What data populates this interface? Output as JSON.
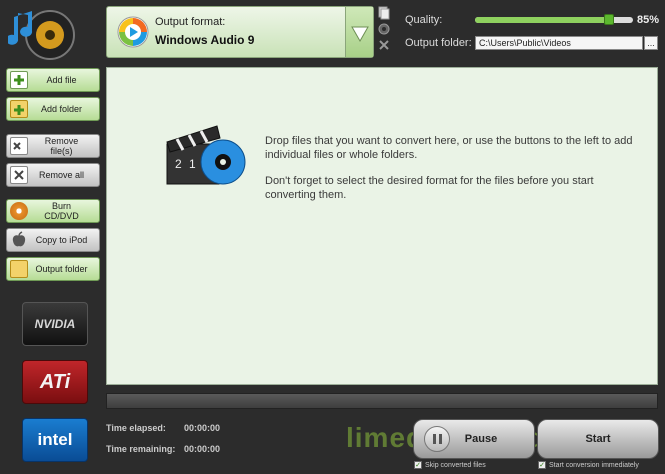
{
  "format": {
    "label": "Output format:",
    "value": "Windows Audio 9"
  },
  "quality": {
    "label": "Quality:",
    "value": "85%",
    "fraction": 0.85
  },
  "output_folder": {
    "label": "Output folder:",
    "value": "C:\\Users\\Public\\Videos",
    "browse_label": "..."
  },
  "sidebar": {
    "items": [
      {
        "label": "Add file",
        "icon": "add-file-icon"
      },
      {
        "label": "Add folder",
        "icon": "add-folder-icon"
      },
      {
        "label": "Remove file(s)",
        "icon": "remove-file-icon"
      },
      {
        "label": "Remove all",
        "icon": "remove-all-icon"
      },
      {
        "label": "Burn CD/DVD",
        "icon": "disc-icon"
      },
      {
        "label": "Copy to iPod",
        "icon": "apple-icon"
      },
      {
        "label": "Output folder",
        "icon": "folder-icon"
      }
    ]
  },
  "brands": {
    "nvidia": "NVIDIA",
    "ati": "ATi",
    "intel": "intel"
  },
  "drop_area": {
    "line1": "Drop files that you want to convert here, or use the buttons to the left to add individual files or whole folders.",
    "line2": "Don't forget to select the desired format for the files before you start converting them."
  },
  "status": {
    "elapsed_label": "Time elapsed:",
    "elapsed_value": "00:00:00",
    "remaining_label": "Time remaining:",
    "remaining_value": "00:00:00"
  },
  "controls": {
    "pause_label": "Pause",
    "start_label": "Start",
    "skip_label": "Skip converted files",
    "start_immediately_label": "Start conversion immediately"
  },
  "watermark": "limedownload.com",
  "colors": {
    "accent_green": "#b6dc95",
    "background": "#2c2c2c",
    "drop_area": "#eaf3e6"
  }
}
